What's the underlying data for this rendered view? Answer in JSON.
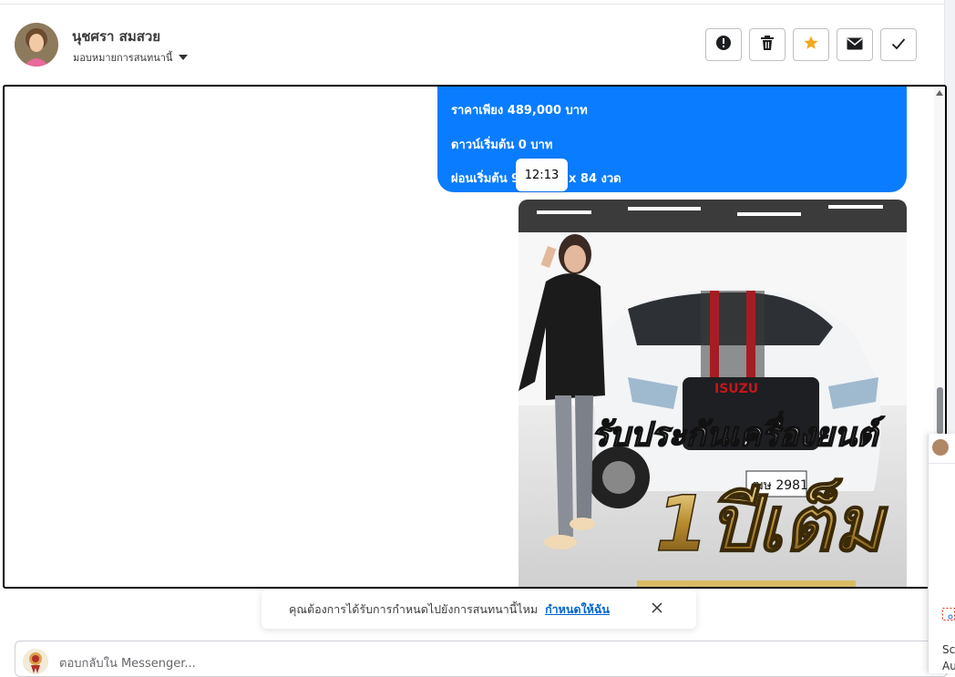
{
  "header": {
    "name": "นุชศรา สมสวย",
    "assign_label": "มอบหมายการสนทนานี้",
    "actions": [
      {
        "icon": "exclamation-circle-icon"
      },
      {
        "icon": "trash-icon"
      },
      {
        "icon": "star-icon",
        "color": "#f5a623"
      },
      {
        "icon": "envelope-icon"
      },
      {
        "icon": "checkmark-icon"
      }
    ]
  },
  "message": {
    "lines": [
      "ราคาเพียง 489,000 บาท",
      "ดาวน์เริ่มต้น 0 บาท",
      "ผ่อนเริ่มต้น 9",
      "x 84 งวด"
    ],
    "time": "12:13",
    "bubble_color": "#0a7cff"
  },
  "photo": {
    "overlay_line1": "รับประกันเครื่องยนต์",
    "overlay_line2": "1ปีเต็ม",
    "brand": "ISUZU",
    "plate": "ฒษ 2981"
  },
  "notice": {
    "text": "คุณต้องการได้รับการกำหนดไปยังการสนทนานี้ไหม",
    "link": "กำหนดให้ฉัน"
  },
  "composer": {
    "placeholder": "ตอบกลับใน Messenger..."
  },
  "side_widget": {
    "line1": "Sc",
    "line2": "Au"
  }
}
